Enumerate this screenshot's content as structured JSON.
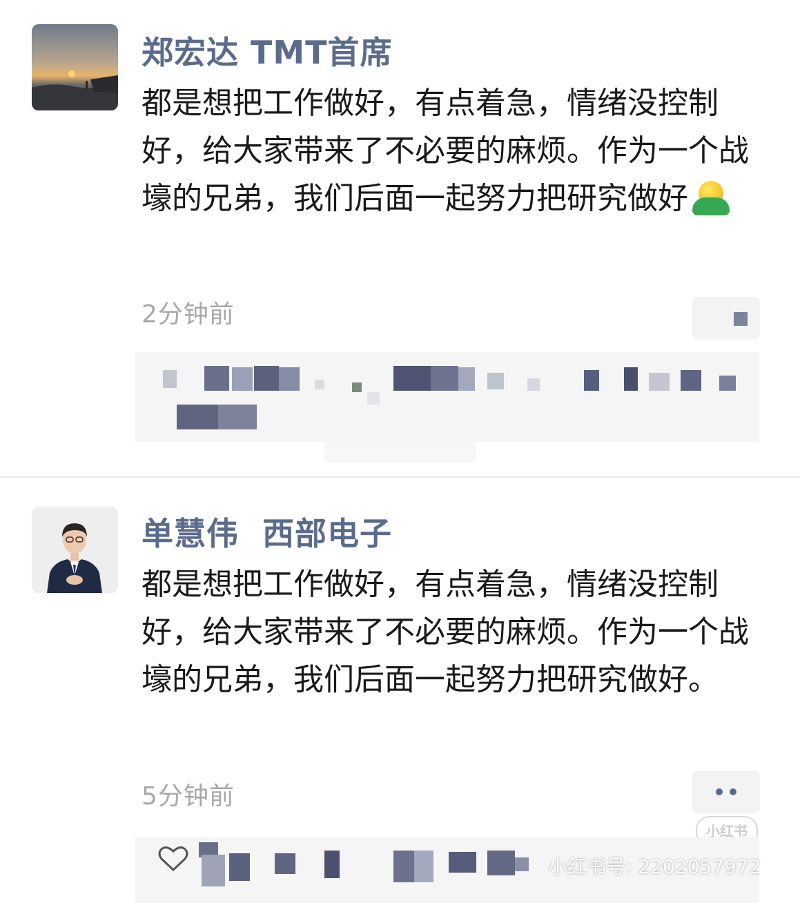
{
  "comments": [
    {
      "author": "郑宏达 TMT首席",
      "text": "都是想把工作做好，有点着急，情绪没控制好，给大家带来了不必要的麻烦。作为一个战壕的兄弟，我们后面一起努力把研究做好",
      "emoji": "hug-emoji",
      "time": "2分钟前"
    },
    {
      "author": "单慧伟  西部电子",
      "text": "都是想把工作做好，有点着急，情绪没控制好，给大家带来了不必要的麻烦。作为一个战壕的兄弟，我们后面一起努力把研究做好。",
      "time": "5分钟前"
    }
  ],
  "watermark": {
    "logo": "小红书",
    "id_text": "小红书号: 2202057972"
  },
  "colors": {
    "author": "#5b6b8c",
    "body": "#191919",
    "time": "#a8a8a8",
    "like_box": "#f5f5f5",
    "divider": "#ececec"
  }
}
